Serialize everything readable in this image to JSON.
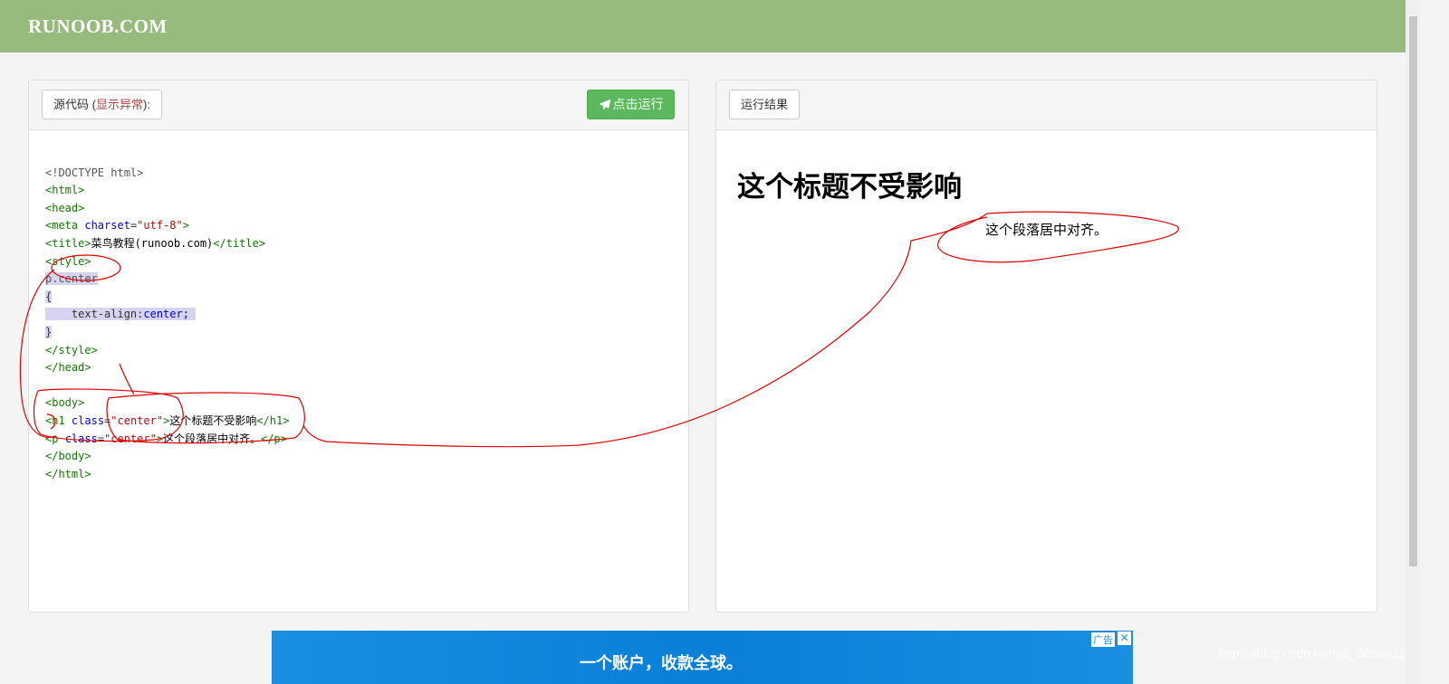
{
  "site": {
    "logo": "RUNOOB.COM"
  },
  "editor": {
    "label_prefix": "源代码",
    "label_open": " (",
    "label_warn": "显示异常",
    "label_close": "):",
    "run_button": "点击运行",
    "lines": {
      "l1": "<!DOCTYPE html>",
      "l2": "<html>",
      "l3": "<head>",
      "l4_a": "<meta",
      "l4_b": "charset",
      "l4_c": "\"utf-8\"",
      "l4_d": ">",
      "l5_a": "<title>",
      "l5_b": "菜鸟教程(runoob.com)",
      "l5_c": "</title>",
      "l6": "<style>",
      "l7": "p.center",
      "l8": "{",
      "l9_a": "    text-align:",
      "l9_b": "center;",
      "l10": "}",
      "l11": "</style>",
      "l12": "</head>",
      "l14": "<body>",
      "l15_a": "<h1",
      "l15_b": "class",
      "l15_c": "\"center\"",
      "l15_d": ">",
      "l15_e": "这个标题不受影响",
      "l15_f": "</h1>",
      "l16_a": "<p",
      "l16_b": "class",
      "l16_c": "\"center\"",
      "l16_d": ">",
      "l16_e": "这个段落居中对齐。",
      "l16_f": "</p>",
      "l17": "</body>",
      "l18": "</html>"
    }
  },
  "result": {
    "label": "运行结果",
    "heading": "这个标题不受影响",
    "paragraph": "这个段落居中对齐。"
  },
  "ad": {
    "text": "一个账户，收款全球。",
    "tag": "广告",
    "close": "✕"
  },
  "watermark": "https://blog.csdn.net/qq_38998213",
  "colors": {
    "header": "#96bb7c",
    "run_button": "#5cb85c",
    "tag": "#117700",
    "attribute": "#0000cc",
    "string": "#aa1111",
    "annotation": "#e00000"
  }
}
